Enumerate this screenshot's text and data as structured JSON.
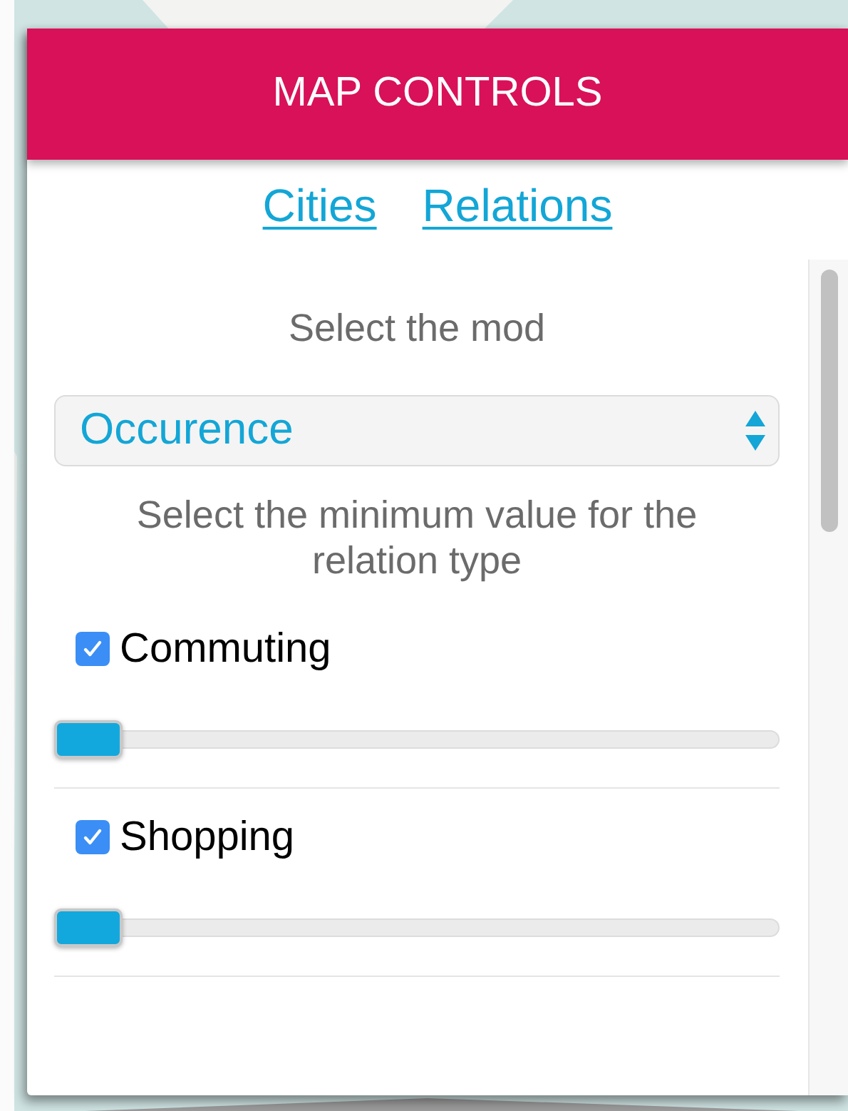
{
  "header": {
    "title": "MAP CONTROLS"
  },
  "tabs": [
    {
      "label": "Cities",
      "selected": false
    },
    {
      "label": "Relations",
      "selected": false
    }
  ],
  "mode_prompt": "Select the mod",
  "mode_select": {
    "value": "Occurence"
  },
  "relation_prompt": "Select the minimum value for the relation type",
  "relations": [
    {
      "label": "Commuting",
      "checked": true,
      "level": 0
    },
    {
      "label": "Shopping",
      "checked": true,
      "level": 0
    }
  ]
}
